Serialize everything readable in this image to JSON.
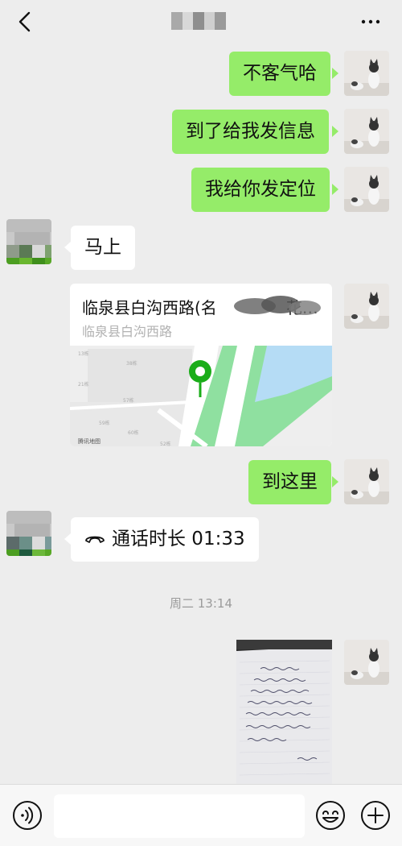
{
  "header": {
    "back_icon": "chevron-left-icon",
    "more_icon": "more-dots-icon"
  },
  "messages": [
    {
      "side": "me",
      "text": "不客气哈"
    },
    {
      "side": "me",
      "text": "到了给我发信息"
    },
    {
      "side": "me",
      "text": "我给你发定位"
    },
    {
      "side": "other",
      "text": "马上"
    },
    {
      "side": "me",
      "type": "location",
      "title": "临泉县白沟西路(名",
      "title_tail": "花…",
      "address": "临泉县白沟西路",
      "map_watermark": "腾讯地图"
    },
    {
      "side": "me",
      "text": "到这里"
    },
    {
      "side": "other",
      "type": "call",
      "text": "通话时长 01:33"
    },
    {
      "side": "me",
      "type": "image",
      "description": "handwritten note photo"
    }
  ],
  "time_separator": "周二 13:14",
  "input_bar": {
    "voice_icon": "voice-icon",
    "emoji_icon": "emoji-icon",
    "plus_icon": "plus-icon",
    "input_value": ""
  },
  "colors": {
    "background": "#ededed",
    "my_bubble": "#95ec69",
    "other_bubble": "#ffffff",
    "map_pin": "#1aad19"
  }
}
